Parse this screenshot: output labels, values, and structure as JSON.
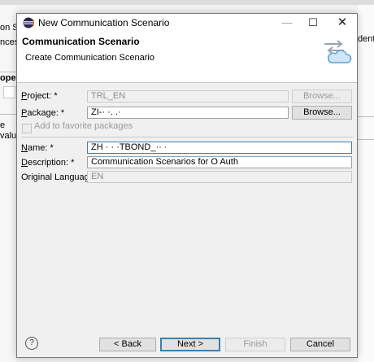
{
  "background": {
    "left_fragments": [
      "on Sc",
      "nces:",
      "oper",
      "e",
      "valu"
    ],
    "right_fragment": "dent"
  },
  "dialog": {
    "title": "New Communication Scenario",
    "window_controls": {
      "minimize": "—",
      "maximize": "☐",
      "close": "✕"
    },
    "header": {
      "title": "Communication Scenario",
      "subtitle": "Create Communication Scenario"
    },
    "form": {
      "project": {
        "label_pre": "",
        "label_key": "P",
        "label_post": "roject: *",
        "value": "TRL_EN",
        "button": "Browse..."
      },
      "package": {
        "label_pre": "",
        "label_key": "P",
        "label_post": "ackage: *",
        "value": "ZI-·  ·. .·",
        "button": "Browse..."
      },
      "favorite": {
        "label": "Add to favorite packages"
      },
      "name": {
        "label_pre": "",
        "label_key": "N",
        "label_post": "ame: *",
        "value": "ZH   ·    ·  ·TBOND_·· ·"
      },
      "description": {
        "label_pre": "",
        "label_key": "D",
        "label_post": "escription: *",
        "value": "Communication Scenarios for O Auth"
      },
      "language": {
        "label": "Original Language:",
        "value": "EN"
      }
    },
    "footer": {
      "help": "?",
      "back": "< Back",
      "next": "Next >",
      "finish": "Finish",
      "cancel": "Cancel"
    },
    "colors": {
      "focus_border": "#3c7fb1",
      "title_bg": "#ffffff",
      "content_bg": "#f0f0f0"
    }
  }
}
